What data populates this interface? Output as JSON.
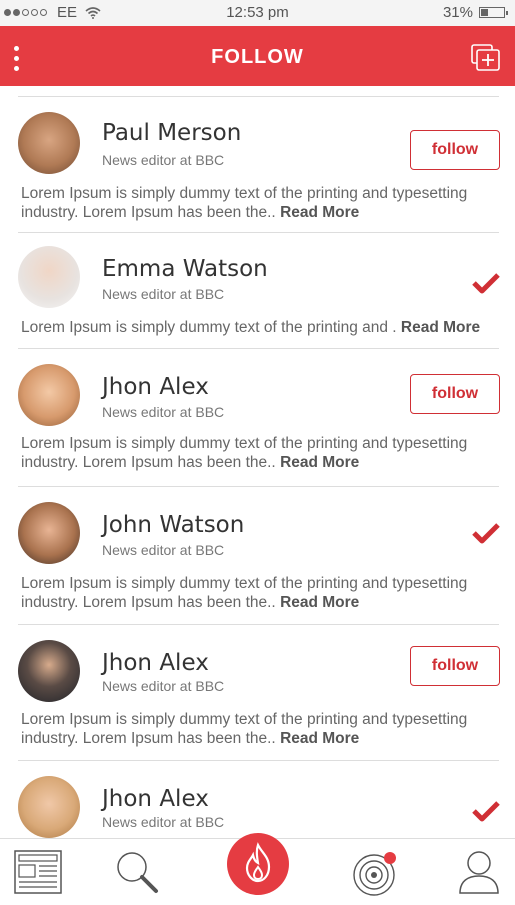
{
  "status_bar": {
    "carrier": "EE",
    "time": "12:53 pm",
    "battery": "31%",
    "battery_level": 0.31
  },
  "header": {
    "title": "FOLLOW"
  },
  "colors": {
    "accent": "#e53c42",
    "button_border": "#d02f35"
  },
  "people": [
    {
      "name": "Paul Merson",
      "role": "News editor at BBC",
      "action": "follow",
      "description": "Lorem Ipsum is simply dummy text of the printing and typesetting industry. Lorem Ipsum has been the..",
      "read_more": "Read More"
    },
    {
      "name": "Emma Watson",
      "role": "News editor at BBC",
      "action": "followed",
      "description": "Lorem Ipsum is simply dummy text of the printing and .",
      "read_more": "Read More"
    },
    {
      "name": "Jhon Alex",
      "role": "News editor at BBC",
      "action": "follow",
      "description": "Lorem Ipsum is simply dummy text of the printing and typesetting industry. Lorem Ipsum has been the..",
      "read_more": "Read More"
    },
    {
      "name": "John Watson",
      "role": "News editor at BBC",
      "action": "followed",
      "description": "Lorem Ipsum is simply dummy text of the printing and typesetting industry. Lorem Ipsum has been the..",
      "read_more": "Read More"
    },
    {
      "name": "Jhon Alex",
      "role": "News editor at BBC",
      "action": "follow",
      "description": "Lorem Ipsum is simply dummy text of the printing and typesetting industry. Lorem Ipsum has been the..",
      "read_more": "Read More"
    },
    {
      "name": "Jhon Alex",
      "role": "News editor at BBC",
      "action": "followed",
      "description": "",
      "read_more": ""
    }
  ],
  "follow_label": "follow",
  "bottom_nav": [
    {
      "icon": "news-icon"
    },
    {
      "icon": "search-icon"
    },
    {
      "icon": "fire-icon"
    },
    {
      "icon": "target-icon",
      "has_notification": true
    },
    {
      "icon": "profile-icon"
    }
  ]
}
